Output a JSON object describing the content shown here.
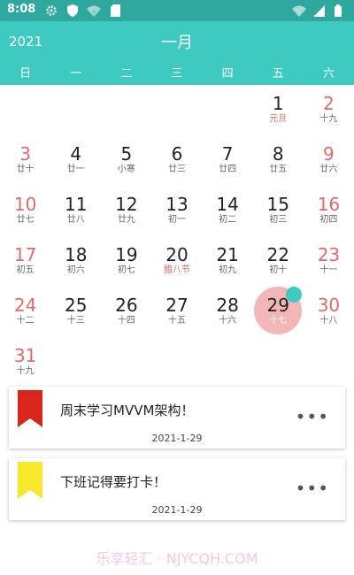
{
  "status_bar": {
    "time": "8:08",
    "icons_left": [
      "settings-icon",
      "shield-icon",
      "wifi-question-icon",
      "sd-card-icon"
    ],
    "icons_right": [
      "wifi-icon",
      "signal-icon",
      "battery-icon"
    ]
  },
  "header": {
    "year": "2021",
    "month": "一月",
    "weekdays": [
      "日",
      "一",
      "二",
      "三",
      "四",
      "五",
      "六"
    ],
    "bg_color": "#3ecac0"
  },
  "calendar": {
    "weeks": [
      [
        {
          "day": "",
          "lunar": ""
        },
        {
          "day": "",
          "lunar": ""
        },
        {
          "day": "",
          "lunar": ""
        },
        {
          "day": "",
          "lunar": ""
        },
        {
          "day": "",
          "lunar": ""
        },
        {
          "day": "1",
          "lunar": "元旦",
          "festival": true
        },
        {
          "day": "2",
          "lunar": "十九"
        }
      ],
      [
        {
          "day": "3",
          "lunar": "廿十"
        },
        {
          "day": "4",
          "lunar": "廿一"
        },
        {
          "day": "5",
          "lunar": "小寒"
        },
        {
          "day": "6",
          "lunar": "廿三"
        },
        {
          "day": "7",
          "lunar": "廿四"
        },
        {
          "day": "8",
          "lunar": "廿五"
        },
        {
          "day": "9",
          "lunar": "廿六"
        }
      ],
      [
        {
          "day": "10",
          "lunar": "廿七"
        },
        {
          "day": "11",
          "lunar": "廿八"
        },
        {
          "day": "12",
          "lunar": "廿九"
        },
        {
          "day": "13",
          "lunar": "初一"
        },
        {
          "day": "14",
          "lunar": "初二"
        },
        {
          "day": "15",
          "lunar": "初三"
        },
        {
          "day": "16",
          "lunar": "初四"
        }
      ],
      [
        {
          "day": "17",
          "lunar": "初五"
        },
        {
          "day": "18",
          "lunar": "初六"
        },
        {
          "day": "19",
          "lunar": "初七"
        },
        {
          "day": "20",
          "lunar": "腊八节",
          "festival": true
        },
        {
          "day": "21",
          "lunar": "初九"
        },
        {
          "day": "22",
          "lunar": "初十"
        },
        {
          "day": "23",
          "lunar": "十一"
        }
      ],
      [
        {
          "day": "24",
          "lunar": "十二"
        },
        {
          "day": "25",
          "lunar": "十三"
        },
        {
          "day": "26",
          "lunar": "十四"
        },
        {
          "day": "27",
          "lunar": "十五"
        },
        {
          "day": "28",
          "lunar": "十六"
        },
        {
          "day": "29",
          "lunar": "十七",
          "selected": true,
          "has_event": true
        },
        {
          "day": "30",
          "lunar": "十八"
        }
      ],
      [
        {
          "day": "31",
          "lunar": "十九"
        },
        {
          "day": "",
          "lunar": ""
        },
        {
          "day": "",
          "lunar": ""
        },
        {
          "day": "",
          "lunar": ""
        },
        {
          "day": "",
          "lunar": ""
        },
        {
          "day": "",
          "lunar": ""
        },
        {
          "day": "",
          "lunar": ""
        }
      ]
    ],
    "weekend_color": "#e06a6a",
    "selected_color": "#f3b6b6"
  },
  "events": [
    {
      "title": "周末学习MVVM架构！",
      "date": "2021-1-29",
      "flag_color": "#d9261c",
      "more_label": "•••"
    },
    {
      "title": "下班记得要打卡！",
      "date": "2021-1-29",
      "flag_color": "#f7e82d",
      "more_label": "•••"
    }
  ],
  "watermark": "乐享轻汇 · NJYCQH.COM"
}
